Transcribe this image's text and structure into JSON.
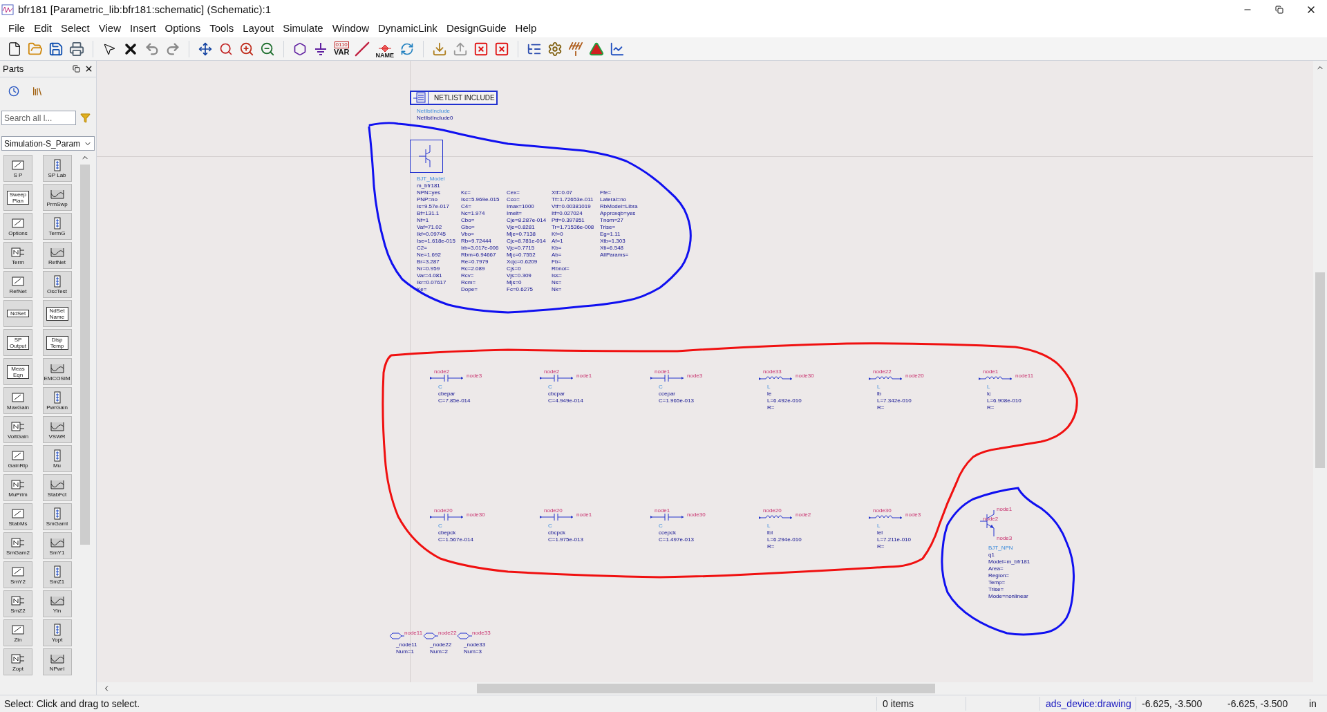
{
  "window": {
    "title": "bfr181 [Parametric_lib:bfr181:schematic] (Schematic):1"
  },
  "menu": [
    "File",
    "Edit",
    "Select",
    "View",
    "Insert",
    "Options",
    "Tools",
    "Layout",
    "Simulate",
    "Window",
    "DynamicLink",
    "DesignGuide",
    "Help"
  ],
  "toolbar": {
    "var_bits": "0110",
    "var_label": "VAR",
    "name_label": "NAME"
  },
  "parts_panel": {
    "title": "Parts",
    "search_placeholder": "Search all l...",
    "library": "Simulation-S_Param",
    "items": [
      {
        "label": "S P",
        "kind": "below"
      },
      {
        "label": "SP Lab",
        "kind": "below"
      },
      {
        "label": "Sweep Plan",
        "kind": "inside"
      },
      {
        "label": "PrmSwp",
        "kind": "below"
      },
      {
        "label": "Options",
        "kind": "below"
      },
      {
        "label": "TermG",
        "kind": "below"
      },
      {
        "label": "Term",
        "kind": "below"
      },
      {
        "label": "RefNet",
        "kind": "below"
      },
      {
        "label": "RefNet",
        "kind": "below"
      },
      {
        "label": "OscTest",
        "kind": "below"
      },
      {
        "label": "NdSet",
        "kind": "inside"
      },
      {
        "label": "NdSet Name",
        "kind": "inside"
      },
      {
        "label": "SP Output",
        "kind": "inside"
      },
      {
        "label": "Disp Temp",
        "kind": "inside"
      },
      {
        "label": "Meas Eqn",
        "kind": "inside"
      },
      {
        "label": "EMCOSIM",
        "kind": "below"
      },
      {
        "label": "MaxGain",
        "kind": "below"
      },
      {
        "label": "PwrGain",
        "kind": "below"
      },
      {
        "label": "VoltGain",
        "kind": "below"
      },
      {
        "label": "VSWR",
        "kind": "below"
      },
      {
        "label": "GainRip",
        "kind": "below"
      },
      {
        "label": "Mu",
        "kind": "below"
      },
      {
        "label": "MuPrim",
        "kind": "below"
      },
      {
        "label": "StabFct",
        "kind": "below"
      },
      {
        "label": "StabMs",
        "kind": "below"
      },
      {
        "label": "SmGamI",
        "kind": "below"
      },
      {
        "label": "SmGam2",
        "kind": "below"
      },
      {
        "label": "SmY1",
        "kind": "below"
      },
      {
        "label": "SmY2",
        "kind": "below"
      },
      {
        "label": "SmZ1",
        "kind": "below"
      },
      {
        "label": "SmZ2",
        "kind": "below"
      },
      {
        "label": "Yin",
        "kind": "below"
      },
      {
        "label": "Zin",
        "kind": "below"
      },
      {
        "label": "Yopt",
        "kind": "below"
      },
      {
        "label": "Zopt",
        "kind": "below"
      },
      {
        "label": "NPwrI",
        "kind": "below"
      }
    ]
  },
  "schematic": {
    "netlist_include": {
      "title": "NETLIST INCLUDE",
      "type": "NetlistInclude",
      "instance": "NetlistInclude0"
    },
    "bjt_model": {
      "type": "BJT_Model",
      "name": "m_bfr181",
      "columns": [
        [
          "NPN=yes",
          "PNP=no",
          "Is=9.57e-017",
          "Bf=131.1",
          "Nf=1",
          "Vaf=71.02",
          "Ikf=0.09745",
          "Ise=1.618e-015",
          "C2=",
          "Ne=1.692",
          "Br=3.287",
          "Nr=0.959",
          "Var=4.081",
          "Ikr=0.07617",
          "Ke="
        ],
        [
          "Kc=",
          "Isc=5.969e-015",
          "C4=",
          "Nc=1.974",
          "Cbo=",
          "Gbo=",
          "Vbo=",
          "Rb=9.72444",
          "Irb=3.017e-006",
          "Rbm=6.94667",
          "Re=0.7979",
          "Rc=2.089",
          "Rcv=",
          "Rcm=",
          "Dope="
        ],
        [
          "Cex=",
          "Cco=",
          "Imax=1000",
          "Imelt=",
          "Cje=8.287e-014",
          "Vje=0.8281",
          "Mje=0.7138",
          "Cjc=8.781e-014",
          "Vjc=0.7715",
          "Mjc=0.7552",
          "Xcjc=0.6209",
          "Cjs=0",
          "Vjs=0.309",
          "Mjs=0",
          "Fc=0.6275"
        ],
        [
          "Xtf=0.07",
          "Tf=1.72653e-011",
          "Vtf=0.00381019",
          "Itf=0.027024",
          "Ptf=0.397851",
          "Tr=1.71536e-008",
          "Kf=0",
          "Af=1",
          "Kb=",
          "Ab=",
          "Fb=",
          "Rbnoi=",
          "Iss=",
          "Ns=",
          "Nk="
        ],
        [
          "Ffe=",
          "Lateral=no",
          "RbModel=Libra",
          "Approxqb=yes",
          "Tnom=27",
          "Trise=",
          "Eg=1.11",
          "Xtb=1.303",
          "Xti=6.548",
          "AllParams="
        ]
      ]
    },
    "component_rows": [
      [
        {
          "kind": "capacitor",
          "type": "C",
          "name": "cbepar",
          "params": [
            "C=7.85e-014"
          ],
          "node_left": "node2",
          "node_right": "node3"
        },
        {
          "kind": "capacitor",
          "type": "C",
          "name": "cbcpar",
          "params": [
            "C=4.949e-014"
          ],
          "node_left": "node2",
          "node_right": "node1"
        },
        {
          "kind": "capacitor",
          "type": "C",
          "name": "ccepar",
          "params": [
            "C=1.965e-013"
          ],
          "node_left": "node1",
          "node_right": "node3"
        },
        {
          "kind": "inductor",
          "type": "L",
          "name": "le",
          "params": [
            "L=6.492e-010",
            "R="
          ],
          "node_left": "node33",
          "node_right": "node30"
        },
        {
          "kind": "inductor",
          "type": "L",
          "name": "lb",
          "params": [
            "L=7.342e-010",
            "R="
          ],
          "node_left": "node22",
          "node_right": "node20"
        },
        {
          "kind": "inductor",
          "type": "L",
          "name": "lc",
          "params": [
            "L=6.908e-010",
            "R="
          ],
          "node_left": "node1",
          "node_right": "node11"
        }
      ],
      [
        {
          "kind": "capacitor",
          "type": "C",
          "name": "cbepck",
          "params": [
            "C=1.567e-014"
          ],
          "node_left": "node20",
          "node_right": "node30"
        },
        {
          "kind": "capacitor",
          "type": "C",
          "name": "cbcpck",
          "params": [
            "C=1.975e-013"
          ],
          "node_left": "node20",
          "node_right": "node1"
        },
        {
          "kind": "capacitor",
          "type": "C",
          "name": "ccepck",
          "params": [
            "C=1.497e-013"
          ],
          "node_left": "node1",
          "node_right": "node30"
        },
        {
          "kind": "inductor",
          "type": "L",
          "name": "lbl",
          "params": [
            "L=6.294e-010",
            "R="
          ],
          "node_left": "node20",
          "node_right": "node2"
        },
        {
          "kind": "inductor",
          "type": "L",
          "name": "lel",
          "params": [
            "L=7.211e-010",
            "R="
          ],
          "node_left": "node30",
          "node_right": "node3"
        }
      ]
    ],
    "ports": [
      {
        "net": "node11",
        "name": "_node11",
        "num": "Num=1"
      },
      {
        "net": "node22",
        "name": "_node22",
        "num": "Num=2"
      },
      {
        "net": "node33",
        "name": "_node33",
        "num": "Num=3"
      }
    ],
    "transistor": {
      "node_collector": "node1",
      "node_base": "node2",
      "node_emitter": "node3",
      "type": "BJT_NPN",
      "name": "q1",
      "params": [
        "Model=m_bfr181",
        "Area=",
        "Region=",
        "Temp=",
        "Trise=",
        "Mode=nonlinear"
      ]
    }
  },
  "status_bar": {
    "message": "Select: Click and drag to select.",
    "items": "0 items",
    "layer": "ads_device:drawing",
    "coords": "-6.625, -3.500",
    "coords_2": "-6.625, -3.500",
    "unit": "in"
  }
}
